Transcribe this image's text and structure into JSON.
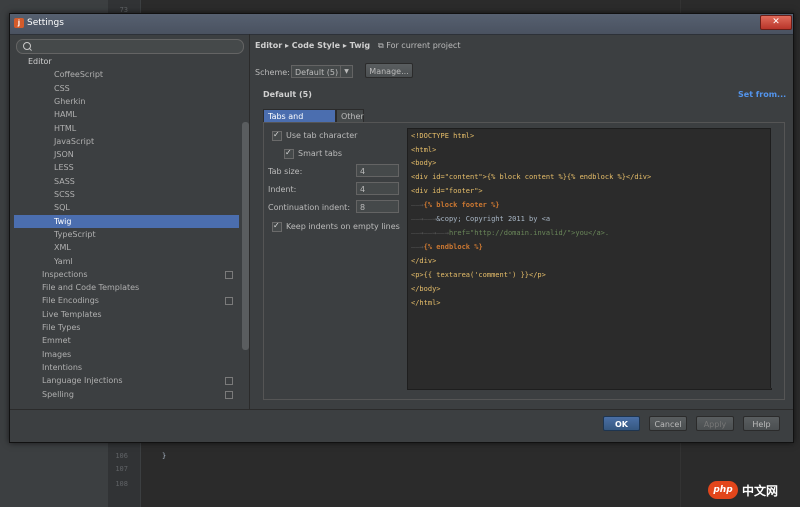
{
  "window": {
    "title": "Settings"
  },
  "watermark": {
    "logo": "php",
    "text": "中文网"
  },
  "background_editor": {
    "line_numbers": [
      "73",
      "106",
      "107",
      "108"
    ],
    "code_line": "}"
  },
  "search": {
    "placeholder": "",
    "value": ""
  },
  "tree": {
    "items": [
      {
        "label": "Editor",
        "level": 0,
        "header": true
      },
      {
        "label": "CoffeeScript",
        "level": 2
      },
      {
        "label": "CSS",
        "level": 2
      },
      {
        "label": "Gherkin",
        "level": 2
      },
      {
        "label": "HAML",
        "level": 2
      },
      {
        "label": "HTML",
        "level": 2
      },
      {
        "label": "JavaScript",
        "level": 2
      },
      {
        "label": "JSON",
        "level": 2
      },
      {
        "label": "LESS",
        "level": 2
      },
      {
        "label": "SASS",
        "level": 2
      },
      {
        "label": "SCSS",
        "level": 2
      },
      {
        "label": "SQL",
        "level": 2
      },
      {
        "label": "Twig",
        "level": 2,
        "selected": true
      },
      {
        "label": "TypeScript",
        "level": 2
      },
      {
        "label": "XML",
        "level": 2
      },
      {
        "label": "Yaml",
        "level": 2
      },
      {
        "label": "Inspections",
        "level": 1,
        "project_icon": true
      },
      {
        "label": "File and Code Templates",
        "level": 1
      },
      {
        "label": "File Encodings",
        "level": 1,
        "project_icon": true
      },
      {
        "label": "Live Templates",
        "level": 1
      },
      {
        "label": "File Types",
        "level": 1
      },
      {
        "label": "Emmet",
        "level": 1
      },
      {
        "label": "Images",
        "level": 1
      },
      {
        "label": "Intentions",
        "level": 1
      },
      {
        "label": "Language Injections",
        "level": 1,
        "project_icon": true
      },
      {
        "label": "Spelling",
        "level": 1,
        "project_icon": true
      }
    ]
  },
  "breadcrumb": {
    "path": "Editor ▸ Code Style ▸ Twig",
    "scope": "For current project"
  },
  "scheme": {
    "label": "Scheme:",
    "value": "Default (5)",
    "manage_label": "Manage...",
    "name": "Default (5)",
    "set_from": "Set from..."
  },
  "tabs": [
    {
      "label": "Tabs and Indents",
      "active": true
    },
    {
      "label": "Other",
      "active": false
    }
  ],
  "options": {
    "use_tab_character": {
      "label": "Use tab character",
      "checked": true
    },
    "smart_tabs": {
      "label": "Smart tabs",
      "checked": true
    },
    "tab_size": {
      "label": "Tab size:",
      "value": "4"
    },
    "indent": {
      "label": "Indent:",
      "value": "4"
    },
    "continuation_indent": {
      "label": "Continuation indent:",
      "value": "8"
    },
    "keep_indents": {
      "label": "Keep indents on empty lines",
      "checked": true
    }
  },
  "preview_lines": [
    "<!DOCTYPE html>",
    "<html>",
    "<body>",
    "<div id=\"content\">{% block content %}{% endblock %}</div>",
    "<div id=\"footer\">",
    "{% block footer %}",
    "&copy; Copyright 2011 by <a",
    "href=\"http://domain.invalid/\">you</a>.",
    "{% endblock %}",
    "</div>",
    "<p>{{ textarea('comment') }}</p>",
    "</body>",
    "</html>"
  ],
  "buttons": {
    "ok": "OK",
    "cancel": "Cancel",
    "apply": "Apply",
    "help": "Help"
  },
  "colors": {
    "selection": "#4b6eaf",
    "link": "#5394ec",
    "keyword": "#cc7832",
    "background": "#3c3f41"
  }
}
